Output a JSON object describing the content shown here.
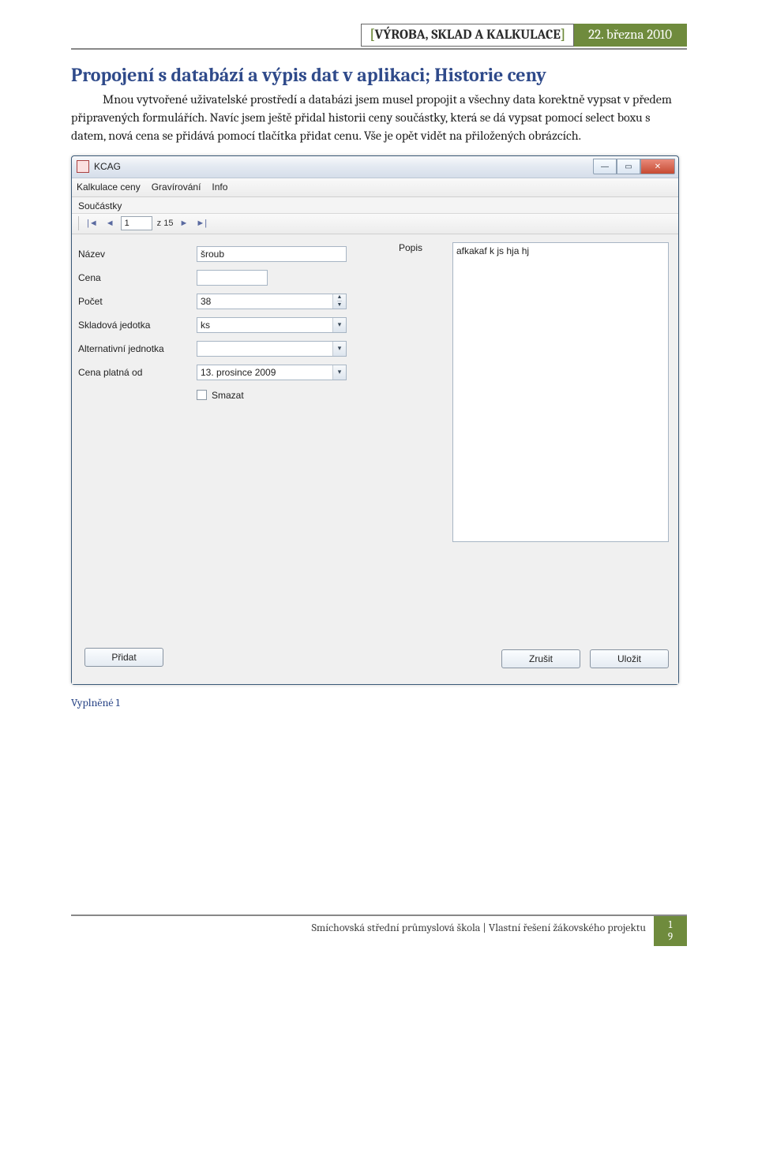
{
  "header": {
    "title_inner": "VÝROBA, SKLAD A KALKULACE",
    "date": "22. března 2010"
  },
  "section": {
    "title": "Propojení s databází a výpis dat v aplikaci; Historie ceny",
    "paragraph": "Mnou vytvořené uživatelské prostředí a databázi jsem musel propojit a všechny data korektně vypsat v předem připravených formulářích. Navíc jsem ještě přidal historii ceny součástky, která se dá vypsat pomocí select boxu s datem, nová cena se přidává pomocí tlačítka přidat cenu. Vše je opět vidět na přiložených obrázcích."
  },
  "app": {
    "title": "KCAG",
    "menu": {
      "item1": "Kalkulace ceny",
      "item2": "Gravírování",
      "item3": "Info"
    },
    "sublabel": "Součástky",
    "nav": {
      "pos": "1",
      "of_prefix": "z",
      "total": "15"
    },
    "fields": {
      "nazev_label": "Název",
      "nazev_value": "šroub",
      "cena_label": "Cena",
      "cena_value": "",
      "pocet_label": "Počet",
      "pocet_value": "38",
      "sklj_label": "Skladová jedotka",
      "sklj_value": "ks",
      "altj_label": "Alternativní jednotka",
      "altj_value": "",
      "cenaod_label": "Cena platná od",
      "cenaod_value": "13. prosince 2009",
      "smazat_label": "Smazat",
      "popis_label": "Popis",
      "popis_value": "afkakaf k js hja hj"
    },
    "buttons": {
      "pridat": "Přidat",
      "zrusit": "Zrušit",
      "ulozit": "Uložit"
    }
  },
  "caption": "Vyplněné 1",
  "footer": {
    "text": "Smíchovská střední průmyslová škola | Vlastní řešení žákovského projektu",
    "page_a": "1",
    "page_b": "9"
  }
}
